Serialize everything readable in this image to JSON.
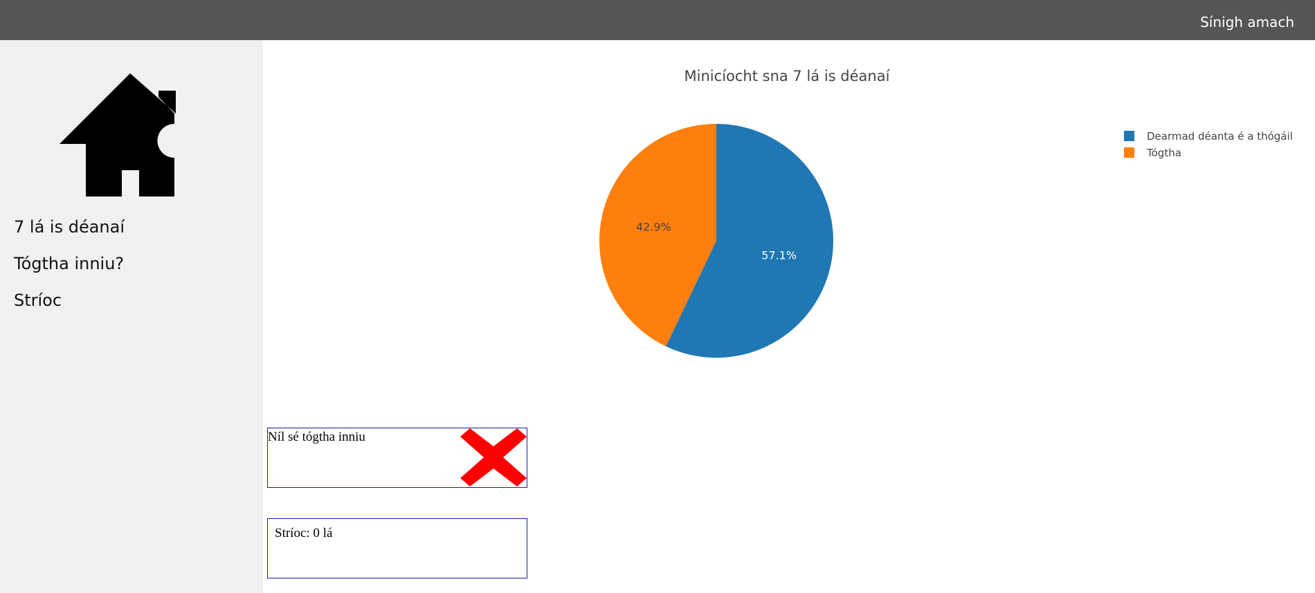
{
  "header": {
    "signout_label": "Sínigh amach"
  },
  "sidebar": {
    "home_icon": "home-icon",
    "items": [
      {
        "label": "7 lá is déanaí"
      },
      {
        "label": "Tógtha inniu?"
      },
      {
        "label": "Stríoc"
      }
    ]
  },
  "chart_data": {
    "type": "pie",
    "title": "Minicíocht sna 7 lá is déanaí",
    "legend_position": "top-right",
    "slices": [
      {
        "name": "Dearmad déanta é a thógáil",
        "value": 57.1,
        "label": "57.1%",
        "color": "#1f77b4",
        "text_color": "#ffffff"
      },
      {
        "name": "Tógtha",
        "value": 42.9,
        "label": "42.9%",
        "color": "#ff7f0e",
        "text_color": "#444444"
      }
    ]
  },
  "status": {
    "text": "Níl sé tógtha inniu",
    "icon": "x-icon",
    "icon_color": "#ff0000"
  },
  "streak": {
    "text": "Stríoc: 0 lá"
  }
}
